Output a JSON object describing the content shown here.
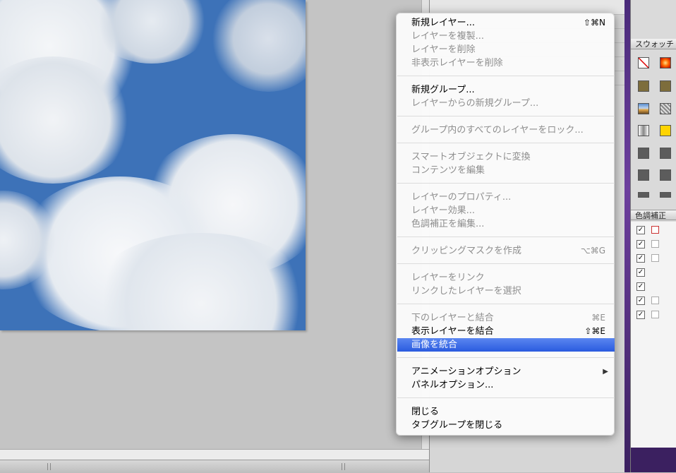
{
  "menu": {
    "items": [
      {
        "label": "新規レイヤー...",
        "shortcut": "⇧⌘N",
        "enabled": true
      },
      {
        "label": "レイヤーを複製...",
        "shortcut": "",
        "enabled": false
      },
      {
        "label": "レイヤーを削除",
        "shortcut": "",
        "enabled": false
      },
      {
        "label": "非表示レイヤーを削除",
        "shortcut": "",
        "enabled": false
      },
      {
        "label": "新規グループ...",
        "shortcut": "",
        "enabled": true
      },
      {
        "label": "レイヤーからの新規グループ...",
        "shortcut": "",
        "enabled": false
      },
      {
        "label": "グループ内のすべてのレイヤーをロック...",
        "shortcut": "",
        "enabled": false
      },
      {
        "label": "スマートオブジェクトに変換",
        "shortcut": "",
        "enabled": false
      },
      {
        "label": "コンテンツを編集",
        "shortcut": "",
        "enabled": false
      },
      {
        "label": "レイヤーのプロパティ...",
        "shortcut": "",
        "enabled": false
      },
      {
        "label": "レイヤー効果...",
        "shortcut": "",
        "enabled": false
      },
      {
        "label": "色調補正を編集...",
        "shortcut": "",
        "enabled": false
      },
      {
        "label": "クリッピングマスクを作成",
        "shortcut": "⌥⌘G",
        "enabled": false
      },
      {
        "label": "レイヤーをリンク",
        "shortcut": "",
        "enabled": false
      },
      {
        "label": "リンクしたレイヤーを選択",
        "shortcut": "",
        "enabled": false
      },
      {
        "label": "下のレイヤーと結合",
        "shortcut": "⌘E",
        "enabled": false
      },
      {
        "label": "表示レイヤーを結合",
        "shortcut": "⇧⌘E",
        "enabled": true
      },
      {
        "label": "画像を統合",
        "shortcut": "",
        "enabled": true,
        "selected": true
      },
      {
        "label": "アニメーションオプション",
        "shortcut": "",
        "enabled": true,
        "submenu": true
      },
      {
        "label": "パネルオプション...",
        "shortcut": "",
        "enabled": true
      },
      {
        "label": "閉じる",
        "shortcut": "",
        "enabled": true
      },
      {
        "label": "タブグループを閉じる",
        "shortcut": "",
        "enabled": true
      }
    ],
    "submenu_arrow": "▶",
    "selected_color": "#3366e6"
  },
  "swatches_panel": {
    "tab_label": "スウォッチ"
  },
  "adjustments_panel": {
    "tab_label": "色調補正",
    "check_glyph": "✓"
  }
}
